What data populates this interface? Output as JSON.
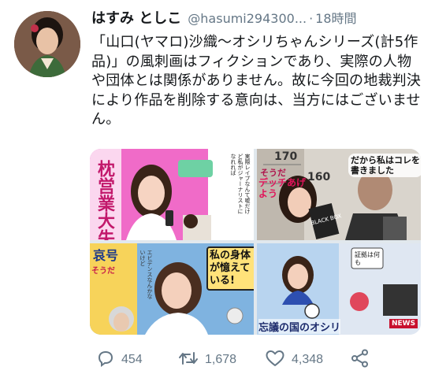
{
  "tweet": {
    "display_name": "はすみ としこ",
    "handle": "@hasumi294300...",
    "separator": "·",
    "timestamp": "18時間",
    "text": "「山口(ヤマロ)沙織〜オシリちゃんシリーズ(計5作品)」の風刺画はフィクションであり、実際の人物や団体とは関係がありません。故に今回の地裁判決により作品を削除する意向は、当方にはございません。"
  },
  "media": {
    "tile1": {
      "vertical_title": "枕営業大失敗",
      "balloon_text": "実際レイプなんて嘘だけど私がジャーナリストになれれば"
    },
    "tile2": {
      "caption_top": "そうだ",
      "caption_main": "デッチあげよう",
      "speech": "だから私はコレを書きました",
      "book_label": "BLACK BOX",
      "numbers": [
        "170",
        "160"
      ]
    },
    "tile3": {
      "caption_left": "哀号",
      "caption_top": "そうだ",
      "speech": "私の身体が憶えている!",
      "small_speech": "エビデンスなんかないけど"
    },
    "tile4": {
      "caption": "忘議の国のオシリ",
      "sub": "証拠は何も",
      "news_badge": "NEWS"
    }
  },
  "actions": {
    "reply_count": "454",
    "retweet_count": "1,678",
    "like_count": "4,348"
  },
  "colors": {
    "text_primary": "#14171a",
    "text_secondary": "#657786",
    "tile1_bg": "#f06bc8",
    "tile3_bg": "#7fb3e0"
  },
  "icons": [
    "reply-icon",
    "retweet-icon",
    "like-icon",
    "share-icon"
  ]
}
